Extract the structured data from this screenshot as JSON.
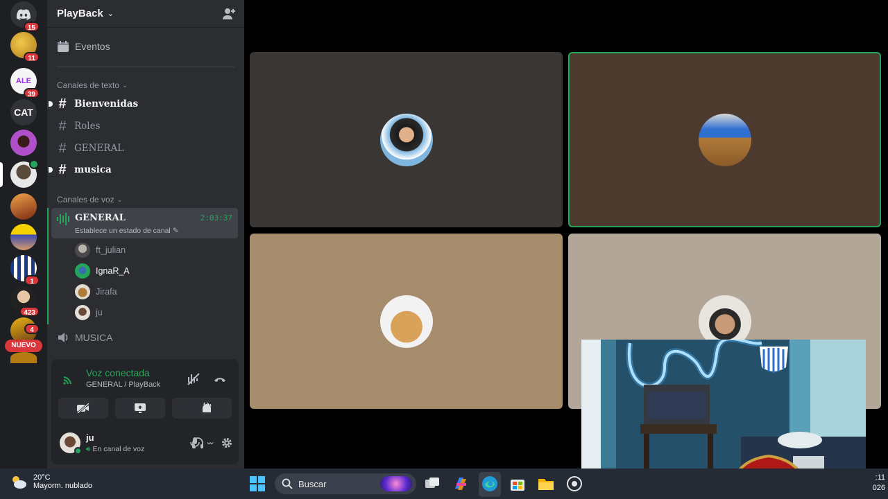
{
  "server_rail": {
    "badges": [
      "15",
      "11",
      "39",
      "1",
      "423",
      "4"
    ],
    "cat_label": "CAT",
    "nuevo_label": "NUEVO"
  },
  "guild": {
    "name": "PlayBack",
    "events_label": "Eventos",
    "text_category": "Canales de texto",
    "text_channels": [
      "Bienvenidas",
      "Roles",
      "GENERAL",
      "musica"
    ],
    "voice_category": "Canales de voz",
    "active_voice": {
      "name": "GENERAL",
      "status": "Establece un estado de canal",
      "time": "2:03:37"
    },
    "voice_users": [
      "ft_julian",
      "IgnaR_A",
      "Jirafa",
      "ju"
    ],
    "other_voice": "MUSICA"
  },
  "panel": {
    "title": "Voz conectada",
    "subtitle": "GENERAL / PlayBack",
    "user_name": "ju",
    "user_status": "En canal de voz"
  },
  "taskbar": {
    "temp": "20°C",
    "weather": "Mayorm. nublado",
    "search_placeholder": "Buscar",
    "clock_line1": ":11",
    "clock_line2": "026"
  },
  "colors": {
    "accent_green": "#23a55a",
    "badge_red": "#da373c"
  }
}
